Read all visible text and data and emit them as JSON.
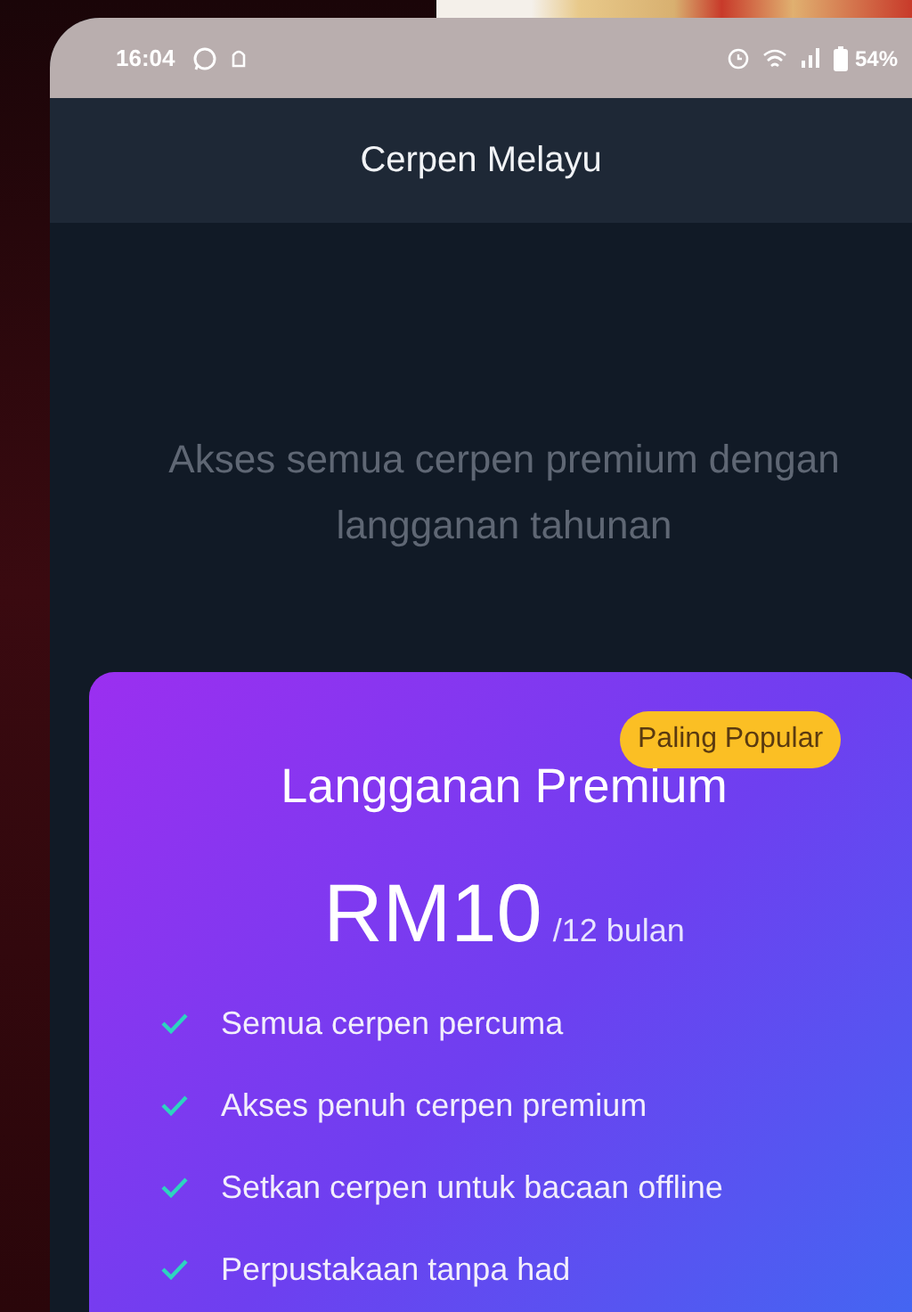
{
  "status_bar": {
    "time": "16:04",
    "battery": "54%"
  },
  "app_bar": {
    "title": "Cerpen Melayu"
  },
  "subtitle": "Akses semua cerpen premium dengan langganan tahunan",
  "plan": {
    "title": "Langganan Premium",
    "badge": "Paling Popular",
    "price": "RM10",
    "period": "/12 bulan",
    "features": [
      "Semua cerpen percuma",
      "Akses penuh cerpen premium",
      "Setkan cerpen untuk bacaan offline",
      "Perpustakaan tanpa had"
    ]
  }
}
